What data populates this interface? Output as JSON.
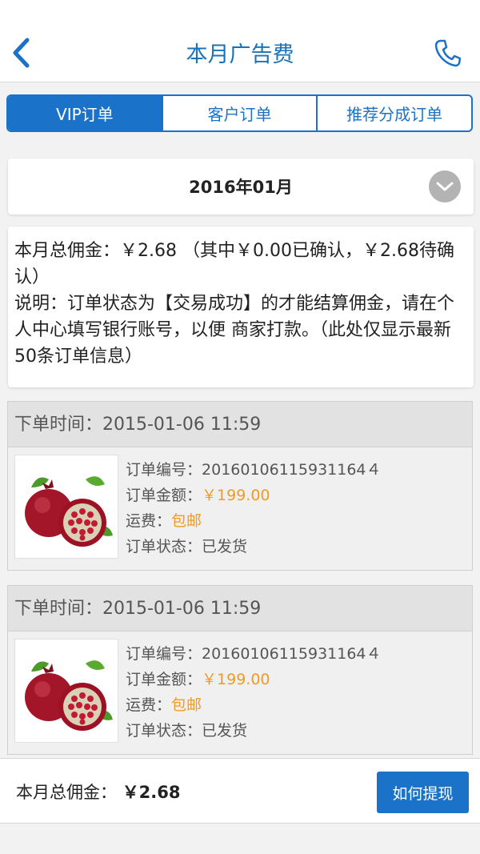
{
  "header": {
    "title": "本月广告费",
    "back_icon": "chevron-left-icon",
    "phone_icon": "phone-icon"
  },
  "tabs": [
    {
      "label": "VIP订单",
      "active": true
    },
    {
      "label": "客户订单",
      "active": false
    },
    {
      "label": "推荐分成订单",
      "active": false
    }
  ],
  "month_selector": {
    "value": "2016年01月",
    "toggle_icon": "chevron-down-icon"
  },
  "info": {
    "line1": "本月总佣金：￥2.68 （其中￥0.00已确认，￥2.68待确认）",
    "line2": "说明：订单状态为【交易成功】的才能结算佣金，请在个人中心填写银行账号，以便 商家打款。（此处仅显示最新50条订单信息）"
  },
  "orders": [
    {
      "time_label": "下单时间：2015-01-06 11:59",
      "order_no_label": "订单编号：",
      "order_no": "20160106115931164４",
      "amount_label": "订单金额：",
      "amount": "￥199.00",
      "shipping_label": "运费：",
      "shipping": "包邮",
      "status_label": "订单状态：",
      "status": "已发货",
      "image": "pomegranate-image"
    },
    {
      "time_label": "下单时间：2015-01-06 11:59",
      "order_no_label": "订单编号：",
      "order_no": "20160106115931164４",
      "amount_label": "订单金额：",
      "amount": "￥199.00",
      "shipping_label": "运费：",
      "shipping": "包邮",
      "status_label": "订单状态：",
      "status": "已发货",
      "image": "pomegranate-image"
    }
  ],
  "footer": {
    "label": "本月总佣金：",
    "amount": "￥2.68",
    "button": "如何提现"
  },
  "colors": {
    "primary": "#1a73c8",
    "orange": "#f39a1e"
  }
}
